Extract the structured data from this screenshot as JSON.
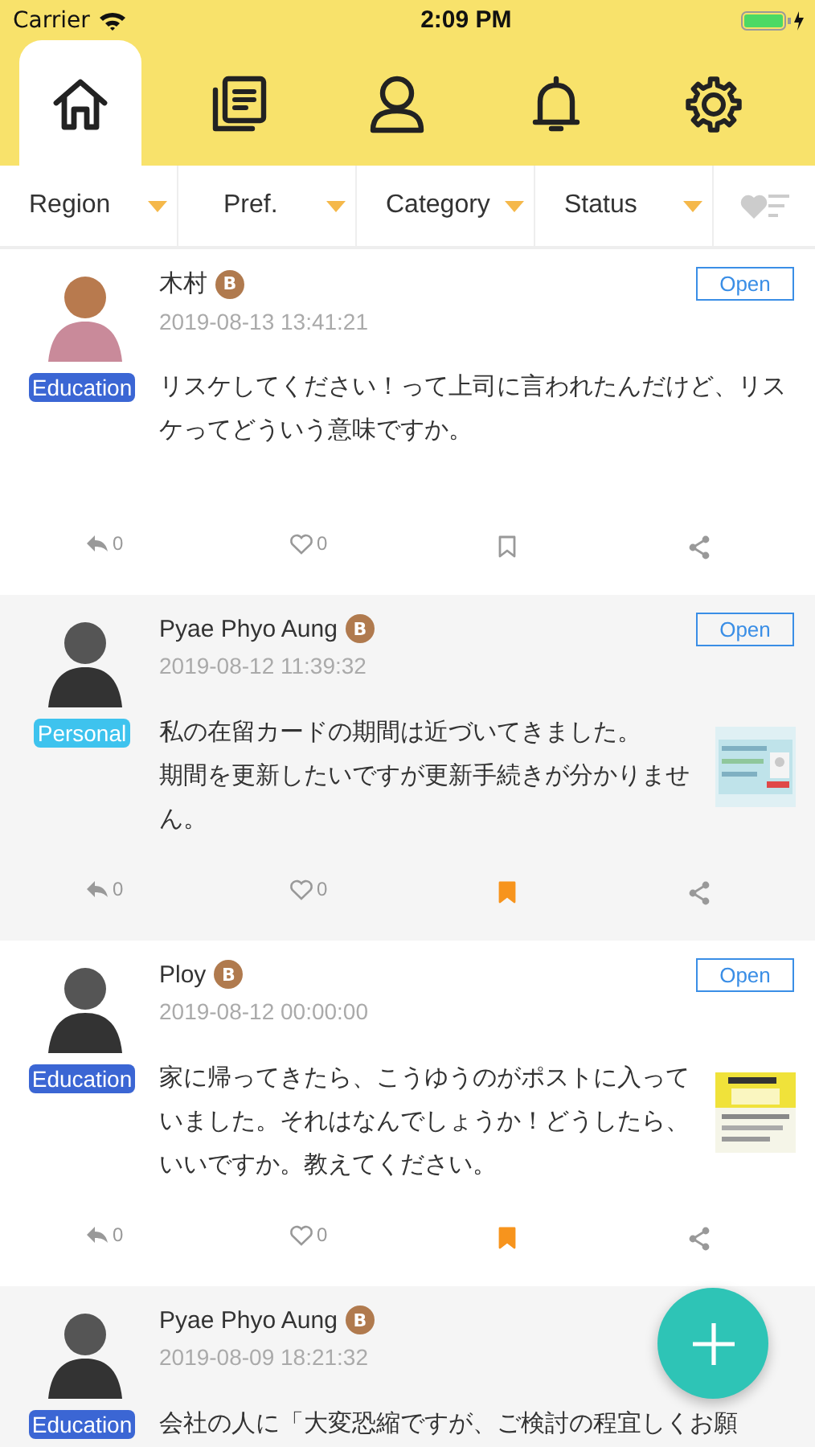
{
  "status_bar": {
    "carrier": "Carrier",
    "time": "2:09 PM"
  },
  "tabs": [
    {
      "kind": "home",
      "selected": true
    },
    {
      "kind": "documents",
      "selected": false
    },
    {
      "kind": "profile",
      "selected": false
    },
    {
      "kind": "notifications",
      "selected": false
    },
    {
      "kind": "settings",
      "selected": false
    }
  ],
  "filters": [
    {
      "label": "Region"
    },
    {
      "label": "Pref."
    },
    {
      "label": "Category"
    },
    {
      "label": "Status"
    }
  ],
  "posts": [
    {
      "author": "木村",
      "badge": "B",
      "date": "2019-08-13 13:41:21",
      "status": "Open",
      "tag": {
        "label": "Education",
        "color": "#3b66d4"
      },
      "text": [
        "リスケしてください！って上司に言われたんだけど、リスケってどういう意味ですか。"
      ],
      "replies": "0",
      "likes": "0",
      "bookmarked": false
    },
    {
      "author": "Pyae Phyo Aung",
      "badge": "B",
      "date": "2019-08-12 11:39:32",
      "status": "Open",
      "tag": {
        "label": "Personal",
        "color": "#3ec3ee"
      },
      "text": [
        "私の在留カードの期間は近づいてきました。",
        "期間を更新したいですが更新手続きが分かりません。"
      ],
      "attachment": {
        "kind": "picture"
      },
      "replies": "0",
      "likes": "0",
      "bookmarked": true
    },
    {
      "author": "Ploy",
      "badge": "B",
      "date": "2019-08-12 00:00:00",
      "status": "Open",
      "tag": {
        "label": "Education",
        "color": "#3b66d4"
      },
      "text": [
        "家に帰ってきたら、こうゆうのがポストに入っていました。それはなんでしょうか！どうしたら、いいですか。教えてください。"
      ],
      "attachment": {
        "kind": "picture"
      },
      "replies": "0",
      "likes": "0",
      "bookmarked": true
    },
    {
      "author": "Pyae Phyo Aung",
      "badge": "B",
      "date": "2019-08-09 18:21:32",
      "tag": {
        "label": "Education",
        "color": "#3b66d4"
      },
      "text": [
        "会社の人に「大変恐縮ですが、ご検討の程宜しくお願"
      ]
    }
  ]
}
